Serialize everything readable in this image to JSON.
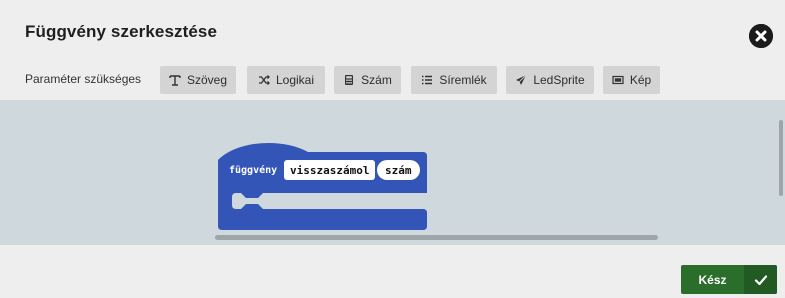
{
  "dialog": {
    "title": "Függvény szerkesztése",
    "close_icon": "close-circle-icon"
  },
  "params": {
    "label": "Paraméter szükséges",
    "buttons": [
      {
        "label": "Szöveg",
        "icon": "text-icon"
      },
      {
        "label": "Logikai",
        "icon": "shuffle-icon"
      },
      {
        "label": "Szám",
        "icon": "calculator-icon"
      },
      {
        "label": "Síremlék",
        "icon": "list-icon"
      },
      {
        "label": "LedSprite",
        "icon": "paper-plane-icon"
      },
      {
        "label": "Kép",
        "icon": "image-icon"
      }
    ]
  },
  "block": {
    "keyword": "függvény",
    "name": "visszaszámol",
    "param": "szám",
    "color": "#3455b8"
  },
  "footer": {
    "done_label": "Kész",
    "done_icon": "checkmark-icon",
    "done_color": "#2b6e2c"
  }
}
